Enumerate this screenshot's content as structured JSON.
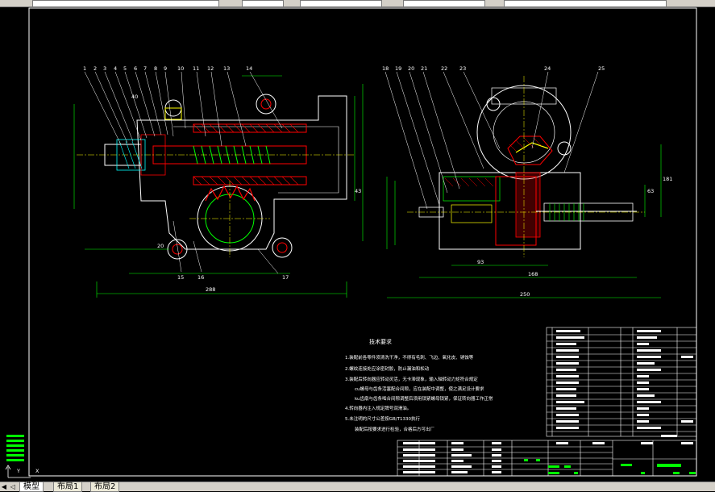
{
  "tabs": [
    {
      "label": "模型"
    },
    {
      "label": "布局1"
    },
    {
      "label": "布局2"
    }
  ],
  "part_numbers_left": [
    "1",
    "2",
    "3",
    "4",
    "5",
    "6",
    "7",
    "8",
    "9",
    "10",
    "11",
    "12",
    "13",
    "14"
  ],
  "part_numbers_left_bottom": [
    "15",
    "16",
    "17"
  ],
  "part_numbers_right": [
    "18",
    "19",
    "20",
    "21",
    "22",
    "23",
    "24",
    "25"
  ],
  "dimensions": {
    "left_overall": "288",
    "right_overall": "250",
    "right_mid": "168",
    "right_small": "93",
    "left_bottom": "20",
    "vert_63": "63",
    "vert_181": "181",
    "left_vert_40": "40",
    "left_vert_43": "43"
  },
  "notes": {
    "title": "技术要求",
    "items": [
      "1.装配前各零件须清洗干净，不得有毛刺、飞边、氧化皮、锈蚀等",
      "2.螺纹连接处应涂密封胶，防止漏油和松动",
      "3.装配后转向器应转动灵活，无卡滞现象，输入轴转动力矩符合规定",
      "cu螺母与齿条活塞配合间隙，应在装配中调整，使之满足设计要求",
      "ku齿扇与齿条啮合间隙调整后须用锁紧螺母锁紧，保证转向器工作正常",
      "4.转向器内注入规定牌号润滑油。",
      "5.未注明的尺寸公差按GB/T1330执行",
      "装配后按要求进行检验，合格后方可出厂"
    ]
  },
  "mini_icons": {
    "axis_x": "X",
    "axis_y": "Y"
  }
}
